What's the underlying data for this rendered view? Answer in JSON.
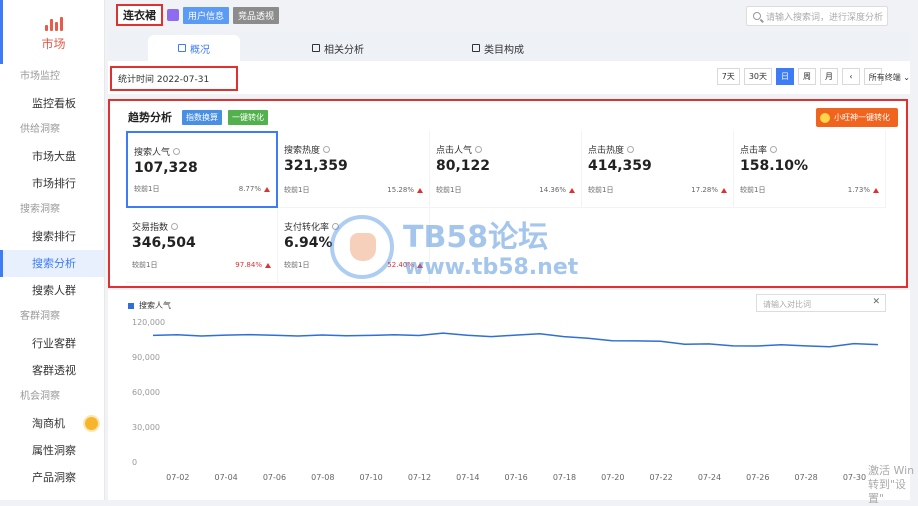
{
  "sidebar": {
    "brand_label": "市场",
    "groups": [
      {
        "title": "市场监控",
        "items": [
          {
            "label": "监控看板",
            "active": false,
            "badge": false
          }
        ]
      },
      {
        "title": "供给洞察",
        "items": [
          {
            "label": "市场大盘",
            "active": false,
            "badge": false
          },
          {
            "label": "市场排行",
            "active": false,
            "badge": false
          }
        ]
      },
      {
        "title": "搜索洞察",
        "items": [
          {
            "label": "搜索排行",
            "active": false,
            "badge": false
          },
          {
            "label": "搜索分析",
            "active": true,
            "badge": false
          },
          {
            "label": "搜索人群",
            "active": false,
            "badge": false
          }
        ]
      },
      {
        "title": "客群洞察",
        "items": [
          {
            "label": "行业客群",
            "active": false,
            "badge": false
          },
          {
            "label": "客群透视",
            "active": false,
            "badge": false
          }
        ]
      },
      {
        "title": "机会洞察",
        "items": [
          {
            "label": "淘商机",
            "active": false,
            "badge": true
          },
          {
            "label": "属性洞察",
            "active": false,
            "badge": false
          },
          {
            "label": "产品洞察",
            "active": false,
            "badge": false
          }
        ]
      }
    ]
  },
  "topbar": {
    "keyword": "连衣裙",
    "tag_user": "用户信息",
    "tag_compete": "竞品透视",
    "search_placeholder": "请输入搜索词，进行深度分析"
  },
  "tabs": [
    {
      "label": "概况",
      "active": true
    },
    {
      "label": "相关分析",
      "active": false
    },
    {
      "label": "类目构成",
      "active": false
    }
  ],
  "timebar": {
    "date_label": "统计时间 2022-07-31",
    "ranges": [
      {
        "label": "7天",
        "active": false
      },
      {
        "label": "30天",
        "active": false
      },
      {
        "label": "日",
        "active": true
      },
      {
        "label": "周",
        "active": false
      },
      {
        "label": "月",
        "active": false
      }
    ],
    "prev": "‹",
    "next": "›",
    "terminal": "所有终端"
  },
  "trend": {
    "title": "趋势分析",
    "btn_convert": "指数换算",
    "btn_one_key": "一键转化",
    "promo_label": "小旺神一键转化",
    "metrics": [
      {
        "label": "搜索人气",
        "value": "107,328",
        "compare": "较前1日",
        "change": "8.77%",
        "hot": false,
        "selected": true
      },
      {
        "label": "搜索热度",
        "value": "321,359",
        "compare": "较前1日",
        "change": "15.28%",
        "hot": false,
        "selected": false
      },
      {
        "label": "点击人气",
        "value": "80,122",
        "compare": "较前1日",
        "change": "14.36%",
        "hot": false,
        "selected": false
      },
      {
        "label": "点击热度",
        "value": "414,359",
        "compare": "较前1日",
        "change": "17.28%",
        "hot": false,
        "selected": false
      },
      {
        "label": "点击率",
        "value": "158.10%",
        "compare": "较前1日",
        "change": "1.73%",
        "hot": false,
        "selected": false
      },
      {
        "label": "交易指数",
        "value": "346,504",
        "compare": "较前1日",
        "change": "97.84%",
        "hot": true,
        "selected": false
      },
      {
        "label": "支付转化率",
        "value": "6.94%",
        "compare": "较前1日",
        "change": "52.40%",
        "hot": true,
        "selected": false
      }
    ]
  },
  "chart_panel": {
    "compare_placeholder": "请输入对比词",
    "close_symbol": "✕"
  },
  "chart_data": {
    "type": "line",
    "series": [
      {
        "name": "搜索人气",
        "color": "#2f6fd6",
        "values": [
          108500,
          109000,
          108000,
          108800,
          109200,
          108600,
          108000,
          108900,
          108200,
          108500,
          109000,
          108400,
          110500,
          108600,
          107500,
          108800,
          110000,
          107500,
          106000,
          104000,
          103800,
          103500,
          101000,
          101200,
          99500,
          99400,
          100500,
          99500,
          98800,
          101500,
          100600,
          104000
        ]
      }
    ],
    "x": [
      "07-01",
      "07-02",
      "07-03",
      "07-04",
      "07-05",
      "07-06",
      "07-07",
      "07-08",
      "07-09",
      "07-10",
      "07-11",
      "07-12",
      "07-13",
      "07-14",
      "07-15",
      "07-16",
      "07-17",
      "07-18",
      "07-19",
      "07-20",
      "07-21",
      "07-22",
      "07-23",
      "07-24",
      "07-25",
      "07-26",
      "07-27",
      "07-28",
      "07-29",
      "07-30",
      "07-31"
    ],
    "x_tick_labels": [
      "07-02",
      "07-04",
      "07-06",
      "07-08",
      "07-10",
      "07-12",
      "07-14",
      "07-16",
      "07-18",
      "07-20",
      "07-22",
      "07-24",
      "07-26",
      "07-28",
      "07-30"
    ],
    "y_ticks": [
      0,
      30000,
      60000,
      90000,
      120000
    ],
    "y_tick_labels": [
      "0",
      "30,000",
      "60,000",
      "90,000",
      "120,000"
    ],
    "ylim": [
      0,
      120000
    ],
    "grid": false,
    "legend": "top-left"
  },
  "watermark": {
    "title": "TB58论坛",
    "url": "www.tb58.net"
  },
  "os_overlay": {
    "line1": "激活 Win",
    "line2": "转到\"设置\""
  }
}
